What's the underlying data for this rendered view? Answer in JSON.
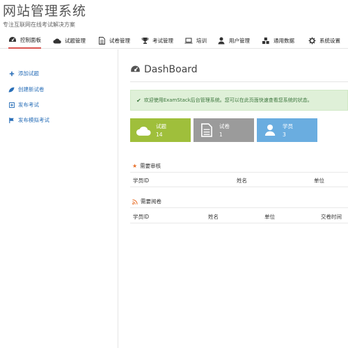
{
  "brand": {
    "title": "网站管理系统",
    "subtitle": "专注互联网在线考试解决方案"
  },
  "colors": {
    "accent": "#d9534f",
    "link": "#2a6fb8",
    "alert_bg": "#dff0d8",
    "alert_text": "#3c763d",
    "stat_green": "#9fbf3b",
    "stat_gray": "#9b9b9b",
    "stat_blue": "#6aade0"
  },
  "nav": {
    "items": [
      {
        "label": "控制面板",
        "icon": "dashboard-icon"
      },
      {
        "label": "试题管理",
        "icon": "cloud-icon"
      },
      {
        "label": "试卷管理",
        "icon": "file-icon"
      },
      {
        "label": "考试管理",
        "icon": "trophy-icon"
      },
      {
        "label": "培训",
        "icon": "laptop-icon"
      },
      {
        "label": "用户管理",
        "icon": "user-icon"
      },
      {
        "label": "通用数据",
        "icon": "cubes-icon"
      },
      {
        "label": "系统设置",
        "icon": "gear-icon"
      }
    ]
  },
  "sidebar": {
    "items": [
      {
        "label": "添加试题",
        "icon": "plus-icon"
      },
      {
        "label": "创建新试卷",
        "icon": "leaf-icon"
      },
      {
        "label": "发布考试",
        "icon": "plus-square-icon"
      },
      {
        "label": "发布模拟考试",
        "icon": "flag-icon"
      }
    ]
  },
  "main": {
    "title": "DashBoard",
    "alert": "欢迎使用ExamStack后台管理系统。您可以在此页面快速查看您系统的状态。",
    "stats": [
      {
        "label": "试题",
        "value": "14",
        "icon": "cloud-icon"
      },
      {
        "label": "试卷",
        "value": "1",
        "icon": "file-icon"
      },
      {
        "label": "学员",
        "value": "3",
        "icon": "user-icon"
      }
    ],
    "review": {
      "heading": "需要审核",
      "icon": "star-icon",
      "columns": [
        "学员ID",
        "姓名",
        "单位"
      ]
    },
    "grading": {
      "heading": "需要阅卷",
      "icon": "rss-icon",
      "columns": [
        "学员ID",
        "姓名",
        "单位",
        "交卷时间"
      ]
    }
  }
}
